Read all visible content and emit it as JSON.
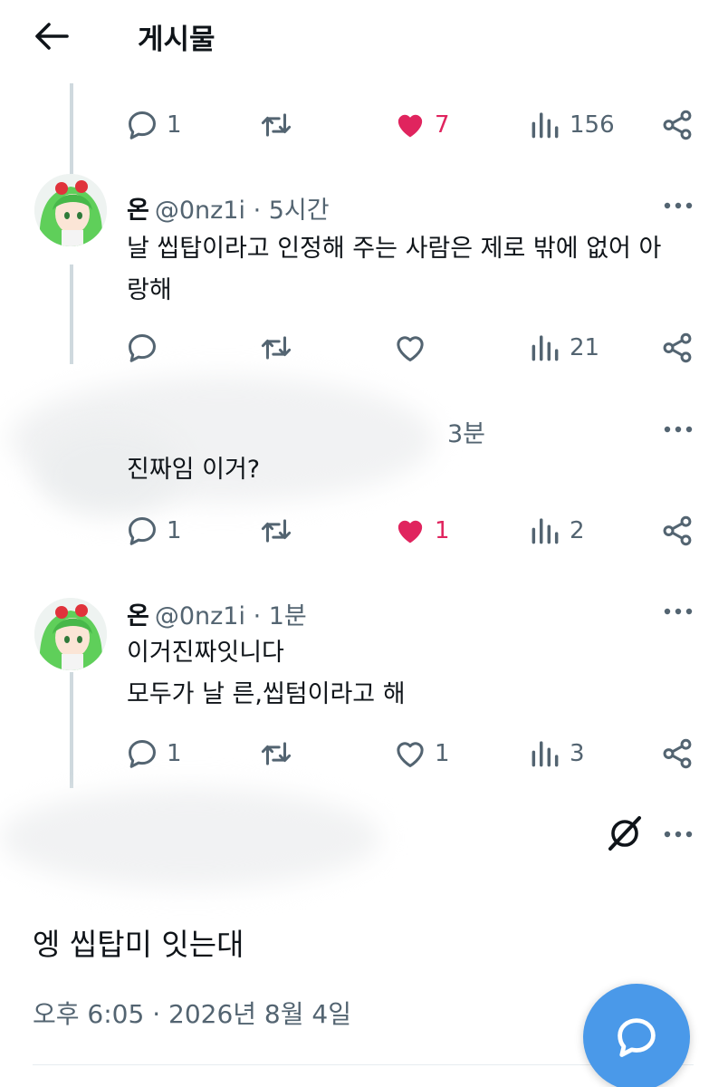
{
  "header": {
    "title": "게시물",
    "back_icon": "arrow-left-icon"
  },
  "colors": {
    "like_pink": "#e0245e",
    "text_gray": "#536471",
    "fab_blue": "#4a99e9",
    "thread_line": "#cfd9de"
  },
  "tweets": [
    {
      "actions": {
        "reply": "1",
        "retweet": "",
        "like": "7",
        "views": "156"
      },
      "liked": true
    },
    {
      "name": "온",
      "handle": "@0nz1i",
      "time": "· 5시간",
      "lines": [
        "날 씹탑이라고 인정해 주는 사람은 제로 밖에 없어 아",
        "랑해"
      ],
      "actions": {
        "reply": "",
        "retweet": "",
        "like": "",
        "views": "21"
      },
      "liked": false
    },
    {
      "name": "",
      "handle": "",
      "time": "3분",
      "lines": [
        "진짜임 이거?"
      ],
      "actions": {
        "reply": "1",
        "retweet": "",
        "like": "1",
        "views": "2"
      },
      "liked": true
    },
    {
      "name": "온",
      "handle": "@0nz1i",
      "time": "· 1분",
      "lines": [
        "이거진짜잇니다",
        "모두가 날 른,씹텀이라고 해"
      ],
      "actions": {
        "reply": "1",
        "retweet": "",
        "like": "1",
        "views": "3"
      },
      "liked": false
    }
  ],
  "main_post": {
    "text": "엥 씹탑미 잇는대",
    "timestamp": "오후 6:05 · 2026년 8월 4일"
  },
  "fab": {
    "icon": "compose-reply-icon"
  }
}
